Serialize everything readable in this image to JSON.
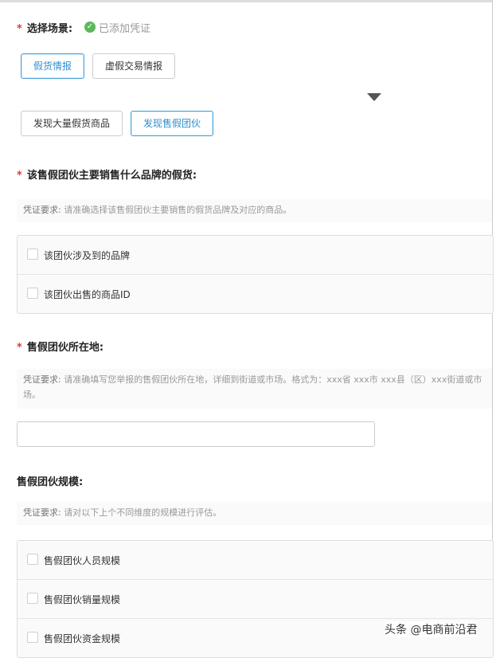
{
  "scenario": {
    "label": "选择场景:",
    "status": "已添加凭证",
    "buttons": [
      "假货情报",
      "虚假交易情报"
    ],
    "subbuttons": [
      "发现大量假货商品",
      "发现售假团伙"
    ]
  },
  "brand": {
    "label": "该售假团伙主要销售什么品牌的假货:",
    "req_key": "凭证要求:",
    "req_text": "请准确选择该售假团伙主要销售的假货品牌及对应的商品。",
    "options": [
      "该团伙涉及到的品牌",
      "该团伙出售的商品ID"
    ]
  },
  "location": {
    "label": "售假团伙所在地:",
    "req_key": "凭证要求:",
    "req_text": "请准确填写您举报的售假团伙所在地，详细到街道或市场。格式为：xxx省 xxx市 xxx县（区）xxx街道或市场。",
    "value": ""
  },
  "scale": {
    "label": "售假团伙规模:",
    "req_key": "凭证要求:",
    "req_text": "请对以下上个不同维度的规模进行评估。",
    "options": [
      "售假团伙人员规模",
      "售假团伙销量规模",
      "售假团伙资金规模"
    ]
  },
  "watermark": "头条 @电商前沿君",
  "colors": {
    "accent": "#4aa3d8",
    "required": "#e4393c",
    "success": "#5cb85c"
  }
}
